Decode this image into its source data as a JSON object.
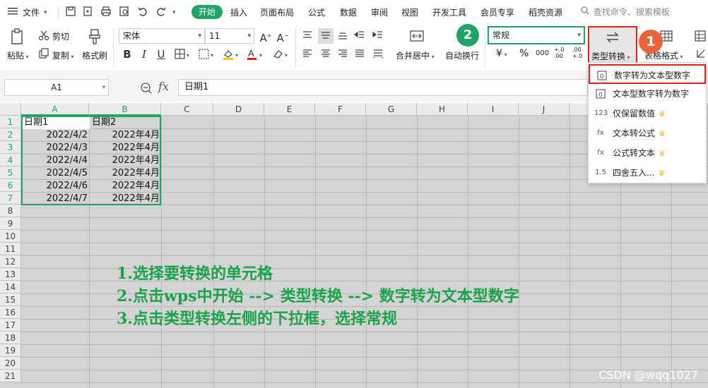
{
  "menubar": {
    "file_label": "文件",
    "tabs": [
      "开始",
      "插入",
      "页面布局",
      "公式",
      "数据",
      "审阅",
      "视图",
      "开发工具",
      "会员专享",
      "稻壳资源"
    ],
    "search_placeholder": "查找命令、搜索模板"
  },
  "ribbon": {
    "paste": "粘贴",
    "cut": "剪切",
    "copy": "复制",
    "format_painter": "格式刷",
    "font_name": "宋体",
    "font_size": "11",
    "merge_center": "合并居中",
    "wrap_text": "自动换行",
    "number_format": "常规",
    "type_convert": "类型转换",
    "table_format": "表格格式",
    "currency_symbol": "¥",
    "percent_symbol": "%",
    "thousands_symbol": "000",
    "inc_decimal": "+.0 .00",
    "dec_decimal": ".00 +.0"
  },
  "formula_bar": {
    "name_box": "A1",
    "fx_label": "fx",
    "content": "日期1"
  },
  "grid": {
    "columns": [
      "A",
      "B",
      "C",
      "D",
      "E",
      "F",
      "G",
      "H",
      "I",
      "J"
    ],
    "rows": [
      "1",
      "2",
      "3",
      "4",
      "5",
      "6",
      "7",
      "8",
      "9",
      "10",
      "11",
      "12",
      "13",
      "14",
      "15",
      "16",
      "17",
      "18",
      "19",
      "20",
      "21"
    ],
    "header_row": [
      "日期1",
      "日期2"
    ],
    "data": [
      [
        "2022/4/2",
        "2022年4月"
      ],
      [
        "2022/4/3",
        "2022年4月"
      ],
      [
        "2022/4/4",
        "2022年4月"
      ],
      [
        "2022/4/5",
        "2022年4月"
      ],
      [
        "2022/4/6",
        "2022年4月"
      ],
      [
        "2022/4/7",
        "2022年4月"
      ]
    ]
  },
  "instructions": [
    "1.选择要转换的单元格",
    "2.点击wps中开始  --> 类型转换 --> 数字转为文本型数字",
    "3.点击类型转换左侧的下拉框，选择常规"
  ],
  "dropdown": {
    "items": [
      {
        "label": "数字转为文本型数字",
        "crown": false
      },
      {
        "label": "文本型数字转为数字",
        "crown": false
      },
      {
        "label": "仅保留数值",
        "crown": true
      },
      {
        "label": "文本转公式",
        "crown": true
      },
      {
        "label": "公式转文本",
        "crown": true
      },
      {
        "label": "四舍五入...",
        "crown": true
      }
    ]
  },
  "badges": {
    "one": "1",
    "two": "2"
  },
  "colors": {
    "accent": "#21a366",
    "highlight_red": "#e02020",
    "instruction_green": "#1aa34a",
    "badge_orange": "#e8633a",
    "badge_green": "#21a366",
    "crown_gold": "#f0b429"
  },
  "watermark": "CSDN @wqq1027"
}
